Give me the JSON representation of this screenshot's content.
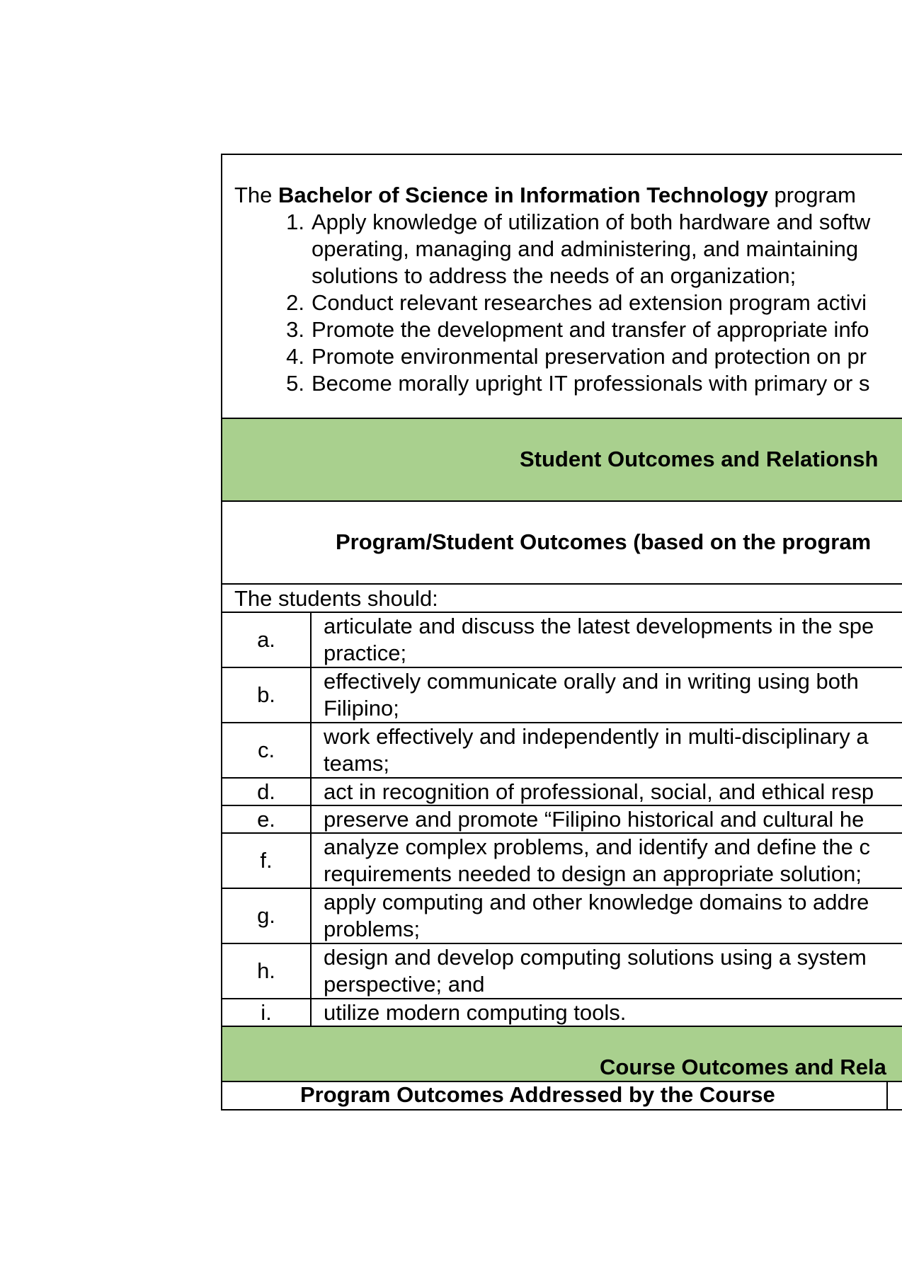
{
  "objectives": {
    "intro_prefix": "The ",
    "intro_bold": "Bachelor of Science in Information Technology",
    "intro_suffix": " program",
    "items": [
      {
        "num": "1.",
        "lines": [
          "Apply knowledge of utilization of both hardware and softw",
          "operating, managing and administering, and maintaining",
          "solutions to address the needs of an organization;"
        ]
      },
      {
        "num": "2.",
        "lines": [
          "Conduct relevant researches ad extension program activi"
        ]
      },
      {
        "num": "3.",
        "lines": [
          "Promote the development and transfer of appropriate info"
        ]
      },
      {
        "num": "4.",
        "lines": [
          "Promote environmental preservation and protection on pr"
        ]
      },
      {
        "num": "5.",
        "lines": [
          "Become morally upright IT professionals with primary or s"
        ]
      }
    ]
  },
  "student_outcomes_band": "Student Outcomes and Relationsh",
  "program_outcomes_title": "Program/Student Outcomes (based on the program",
  "students_should": "The students should:",
  "outcomes": [
    {
      "letter": "a.",
      "lines": [
        "articulate and discuss the latest developments in the spe",
        "practice;"
      ]
    },
    {
      "letter": "b.",
      "lines": [
        "effectively communicate orally and in writing using both",
        "Filipino;"
      ]
    },
    {
      "letter": "c.",
      "lines": [
        "work effectively and independently in multi-disciplinary a",
        "teams;"
      ]
    },
    {
      "letter": "d.",
      "lines": [
        "act in recognition of professional, social, and ethical resp"
      ]
    },
    {
      "letter": "e.",
      "lines": [
        "preserve and promote “Filipino historical and cultural he"
      ]
    },
    {
      "letter": "f.",
      "lines": [
        "analyze complex problems, and identify and define the c",
        "requirements needed to design an appropriate solution;"
      ]
    },
    {
      "letter": "g.",
      "lines": [
        "apply computing and other knowledge domains to addre",
        "problems;"
      ]
    },
    {
      "letter": "h.",
      "lines": [
        "design and develop computing solutions using a system",
        "perspective; and"
      ]
    },
    {
      "letter": "i.",
      "lines": [
        "utilize modern computing tools."
      ]
    }
  ],
  "course_outcomes_band": "Course Outcomes and Rela",
  "program_outcomes_addressed": "Program Outcomes Addressed by the Course",
  "colors": {
    "band_green": "#a9d08e"
  }
}
